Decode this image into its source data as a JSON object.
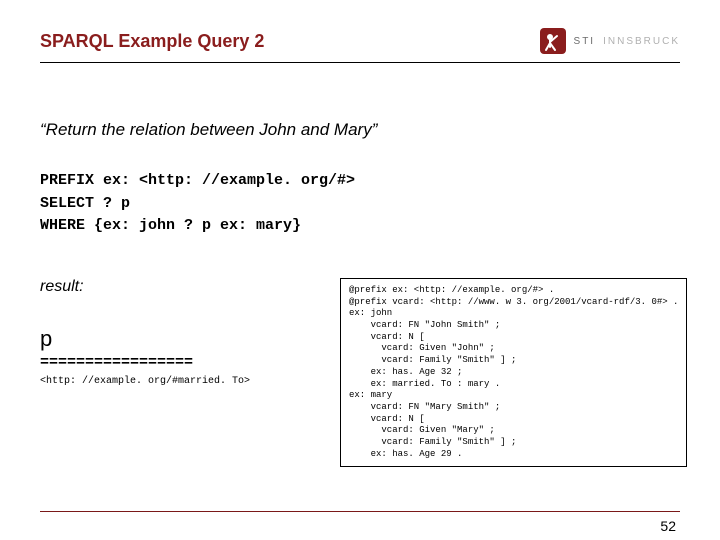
{
  "header": {
    "title": "SPARQL Example Query 2",
    "logo_label": "STI",
    "logo_city": "INNSBRUCK"
  },
  "body": {
    "quote": "“Return the relation between John and Mary”",
    "query_line1": "PREFIX ex: <http: //example. org/#>",
    "query_line2": "SELECT ? p",
    "query_line3": "WHERE {ex: john ? p ex: mary}",
    "result_label": "result:",
    "result_heading": "p",
    "result_separator": "=================",
    "result_uri": "<http: //example. org/#married. To>",
    "rdf_text": "@prefix ex: <http: //example. org/#> .\n@prefix vcard: <http: //www. w 3. org/2001/vcard-rdf/3. 0#> .\nex: john\n    vcard: FN \"John Smith\" ;\n    vcard: N [\n      vcard: Given \"John\" ;\n      vcard: Family \"Smith\" ] ;\n    ex: has. Age 32 ;\n    ex: married. To : mary .\nex: mary\n    vcard: FN \"Mary Smith\" ;\n    vcard: N [\n      vcard: Given \"Mary\" ;\n      vcard: Family \"Smith\" ] ;\n    ex: has. Age 29 ."
  },
  "footer": {
    "page": "52"
  }
}
